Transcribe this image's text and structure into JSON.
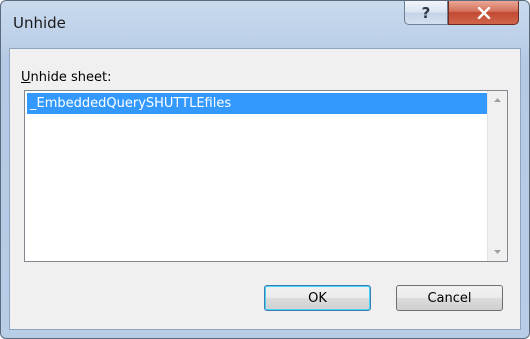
{
  "window": {
    "title": "Unhide"
  },
  "titlebar": {
    "help_icon": "help-icon",
    "help_glyph": "?",
    "close_icon": "close-icon"
  },
  "dialog": {
    "label_prefix": "U",
    "label_rest": "nhide sheet:",
    "sheets": [
      "_EmbeddedQuerySHUTTLEfiles"
    ],
    "selected_index": 0
  },
  "buttons": {
    "ok_label": "OK",
    "cancel_label": "Cancel"
  },
  "colors": {
    "selection": "#3399ff",
    "close_button": "#c14a32"
  }
}
